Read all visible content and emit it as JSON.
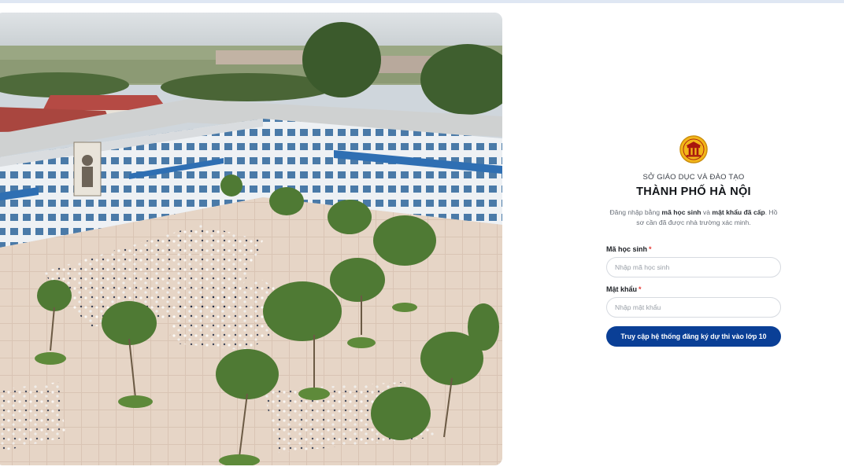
{
  "header": {
    "accent": "#dfe7f3"
  },
  "hero_image": {
    "icon": "school-courtyard-photo"
  },
  "login": {
    "logo": {
      "icon": "hanoi-emblem-icon",
      "color": "#f2b619"
    },
    "org_line": "SỞ GIÁO DỤC VÀ ĐÀO TẠO",
    "city": "THÀNH PHỐ HÀ NỘI",
    "description": {
      "prefix": "Đăng nhập bằng ",
      "bold1": "mã học sinh",
      "mid": " và ",
      "bold2": "mật khẩu đã cấp",
      "suffix": ". Hồ sơ cần đã được nhà trường xác minh."
    },
    "student_id": {
      "label": "Mã học sinh",
      "required": "*",
      "placeholder": "Nhập mã học sinh"
    },
    "password": {
      "label": "Mật khẩu",
      "required": "*",
      "placeholder": "Nhập mật khẩu"
    },
    "submit_label": "Truy cập hệ thống đăng ký dự thi vào lớp 10",
    "button_color": "#0a3f96"
  }
}
